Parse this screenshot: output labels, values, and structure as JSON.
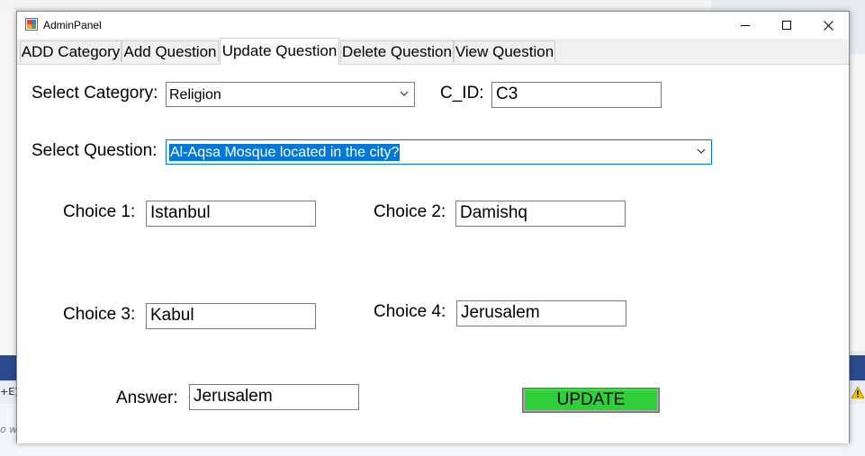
{
  "window": {
    "title": "AdminPanel"
  },
  "tabs": [
    {
      "label": "ADD Category"
    },
    {
      "label": "Add Question"
    },
    {
      "label": "Update Question",
      "active": true
    },
    {
      "label": "Delete Question"
    },
    {
      "label": "View Question"
    }
  ],
  "form": {
    "select_category_label": "Select Category:",
    "category_value": "Religion",
    "cid_label": "C_ID:",
    "cid_value": "C3",
    "select_question_label": "Select Question:",
    "question_value": "Al-Aqsa Mosque located in the city?",
    "choice1_label": "Choice 1:",
    "choice1_value": "Istanbul",
    "choice2_label": "Choice 2:",
    "choice2_value": "Damishq",
    "choice3_label": "Choice 3:",
    "choice3_value": "Kabul",
    "choice4_label": "Choice 4:",
    "choice4_value": "Jerusalem",
    "answer_label": "Answer:",
    "answer_value": "Jerusalem",
    "update_button": "UPDATE"
  },
  "background": {
    "fragment_left": "+E)",
    "fragment_left2": "o w"
  },
  "colors": {
    "update_button_bg": "#2fcf3a",
    "selection_highlight": "#0078d7",
    "background_bar": "#2b4a8e"
  },
  "icons": {
    "app": "app-icon",
    "minimize": "minimize-icon",
    "maximize": "maximize-icon",
    "close": "close-icon",
    "dropdown": "chevron-down-icon",
    "warning": "warning-icon"
  }
}
